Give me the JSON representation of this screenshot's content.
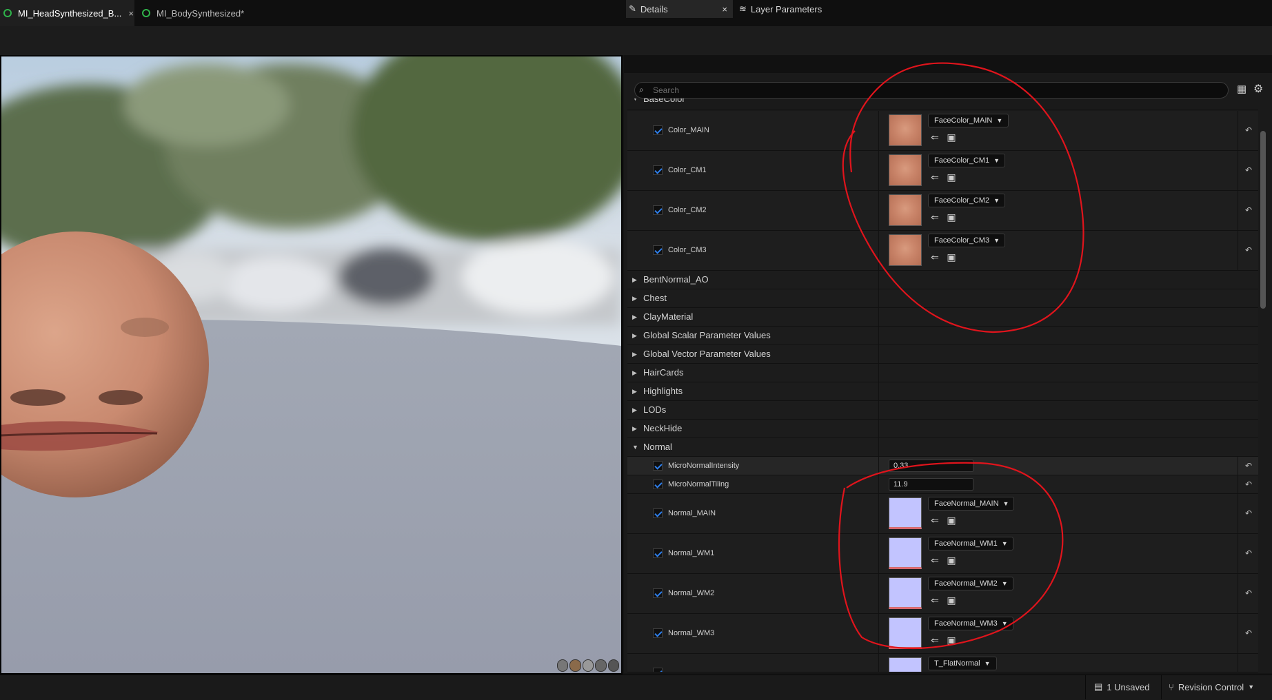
{
  "tabs": [
    {
      "label": "MI_HeadSynthesized_B...",
      "active": true,
      "close": "×"
    },
    {
      "label": "MI_BodySynthesized*",
      "active": false
    }
  ],
  "panel_tabs": {
    "details": "Details",
    "details_close": "×",
    "layer_parameters": "Layer Parameters"
  },
  "search": {
    "placeholder": "Search"
  },
  "sections": {
    "basecolor": "BaseColor",
    "bentnormal": "BentNormal_AO",
    "chest": "Chest",
    "clay": "ClayMaterial",
    "global_scalar": "Global Scalar Parameter Values",
    "global_vector": "Global Vector Parameter Values",
    "haircards": "HairCards",
    "highlights": "Highlights",
    "lods": "LODs",
    "neckhide": "NeckHide",
    "normal": "Normal"
  },
  "color_params": [
    {
      "label": "Color_MAIN",
      "texture": "FaceColor_MAIN"
    },
    {
      "label": "Color_CM1",
      "texture": "FaceColor_CM1"
    },
    {
      "label": "Color_CM2",
      "texture": "FaceColor_CM2"
    },
    {
      "label": "Color_CM3",
      "texture": "FaceColor_CM3"
    }
  ],
  "scalar_params": [
    {
      "label": "MicroNormalIntensity",
      "value": "0.33"
    },
    {
      "label": "MicroNormalTiling",
      "value": "11.9"
    }
  ],
  "normal_params": [
    {
      "label": "Normal_MAIN",
      "texture": "FaceNormal_MAIN"
    },
    {
      "label": "Normal_WM1",
      "texture": "FaceNormal_WM1"
    },
    {
      "label": "Normal_WM2",
      "texture": "FaceNormal_WM2"
    },
    {
      "label": "Normal_WM3",
      "texture": "FaceNormal_WM3"
    },
    {
      "label": "",
      "texture": "T_FlatNormal"
    }
  ],
  "status": {
    "unsaved": "1 Unsaved",
    "revision": "Revision Control"
  },
  "colors": {
    "accent": "#2f80ed",
    "annotation": "#e0141c",
    "normal_swatch": "#c2c4ff"
  }
}
